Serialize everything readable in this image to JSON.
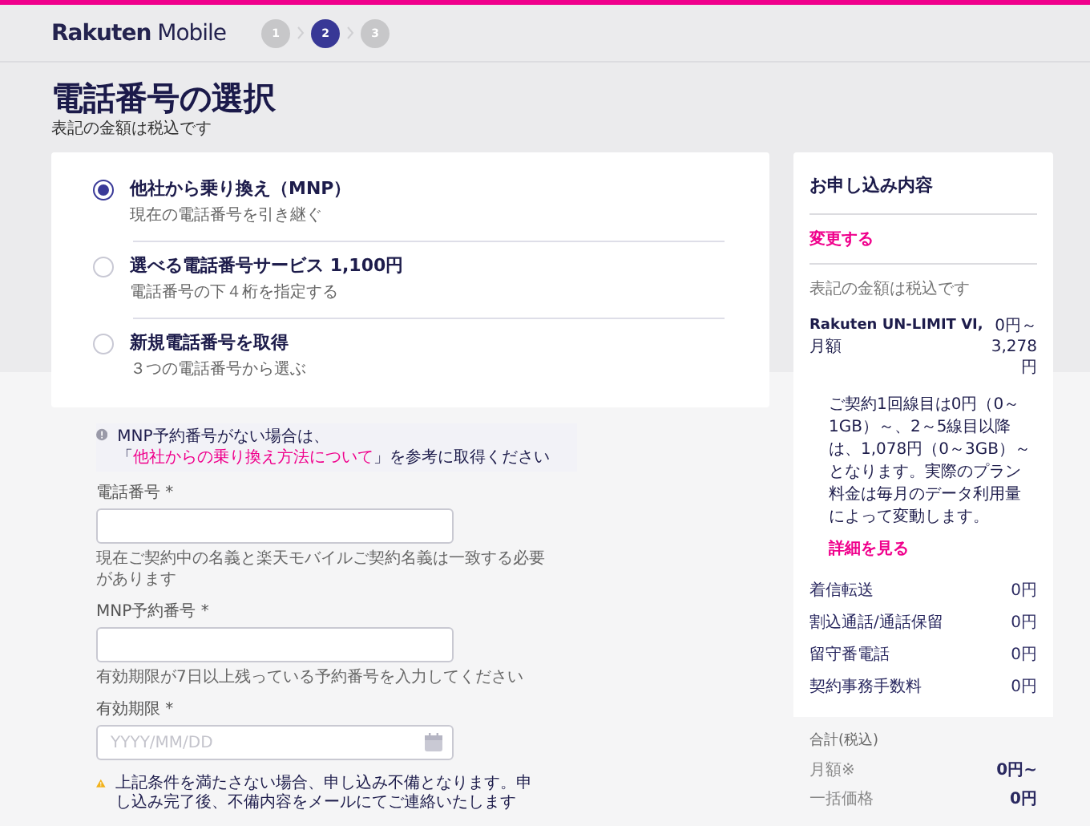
{
  "header": {
    "logo": "**Rakuten** Mobile",
    "steps": [
      {
        "label": "1",
        "selected": false
      },
      {
        "label": "2",
        "selected": true
      },
      {
        "label": "3",
        "selected": false
      }
    ]
  },
  "page": {
    "title": "電話番号の選択",
    "note": "表記の金額は税込です"
  },
  "options": [
    {
      "label": "他社から乗り換え（MNP）",
      "description": "現在の電話番号を引き継ぐ",
      "selected": true
    },
    {
      "label": "選べる電話番号サービス 1,100円",
      "description": "電話番号の下４桁を指定する",
      "selected": false
    },
    {
      "label": "新規電話番号を取得",
      "description": "３つの電話番号から選ぶ",
      "selected": false
    }
  ],
  "info": {
    "text_before": "MNP予約番号がない場合は、「",
    "link": "他社からの乗り換え方法について",
    "text_after": "」を参考に取得ください"
  },
  "fields": [
    {
      "kind": "text",
      "label": "電話番号 *",
      "hint": "現在ご契約中の名義と楽天モバイルご契約名義は一致する必要があります"
    },
    {
      "kind": "text",
      "label": "MNP予約番号 *",
      "hint": "有効期限が7日以上残っている予約番号を入力してください"
    },
    {
      "kind": "date",
      "label": "有効期限 *",
      "placeholder": "YYYY/MM/DD"
    }
  ],
  "warning": "上記条件を満たさない場合、申し込み不備となります。申し込み完了後、不備内容をメールにてご連絡いたします",
  "summary": {
    "title": "お申し込み内容",
    "change_link": "変更する",
    "tax_note": "表記の金額は税込です",
    "plan": {
      "name": "Rakuten UN-LIMIT VI,",
      "period": "月額",
      "price": "0円～3,278円"
    },
    "plan_note": "ご契約1回線目は0円（0～1GB）～、2～5線目以降は、1,078円（0～3GB）～となります。実際のプラン料金は毎月のデータ利用量によって変動します。",
    "detail_link": "詳細を見る",
    "fees": [
      {
        "name": "着信転送",
        "price": "0円"
      },
      {
        "name": "割込通話/通話保留",
        "price": "0円"
      },
      {
        "name": "留守番電話",
        "price": "0円"
      },
      {
        "name": "契約事務手数料",
        "price": "0円"
      }
    ],
    "totals_title": "合計(税込)",
    "totals": [
      {
        "name": "月額※",
        "price": "0円~"
      },
      {
        "name": "一括価格",
        "price": "0円"
      }
    ]
  }
}
